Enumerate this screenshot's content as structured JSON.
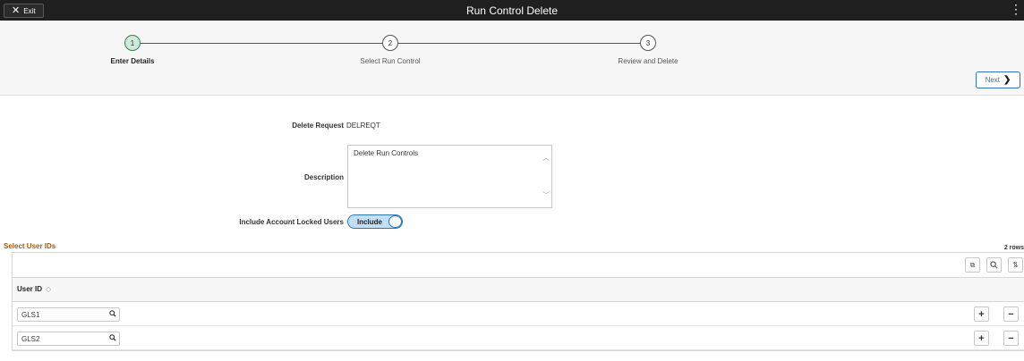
{
  "header": {
    "exit_label": "Exit",
    "title": "Run Control Delete"
  },
  "train": {
    "steps": [
      {
        "number": "1",
        "label": "Enter Details",
        "active": true
      },
      {
        "number": "2",
        "label": "Select Run Control",
        "active": false
      },
      {
        "number": "3",
        "label": "Review and Delete",
        "active": false
      }
    ],
    "next_label": "Next"
  },
  "form": {
    "delete_request_label": "Delete Request",
    "delete_request_value": "DELREQT",
    "description_label": "Description",
    "description_value": "Delete Run Controls",
    "locked_users_label": "Include Account Locked Users",
    "locked_users_toggle": "Include"
  },
  "grid": {
    "title": "Select User IDs",
    "row_count": "2 rows",
    "column_header": "User ID",
    "rows": [
      {
        "user_id": "GLS1"
      },
      {
        "user_id": "GLS2"
      }
    ]
  },
  "colors": {
    "accent": "#2f74b8",
    "section_title": "#a35a11",
    "active_step": "#cfeadb"
  }
}
